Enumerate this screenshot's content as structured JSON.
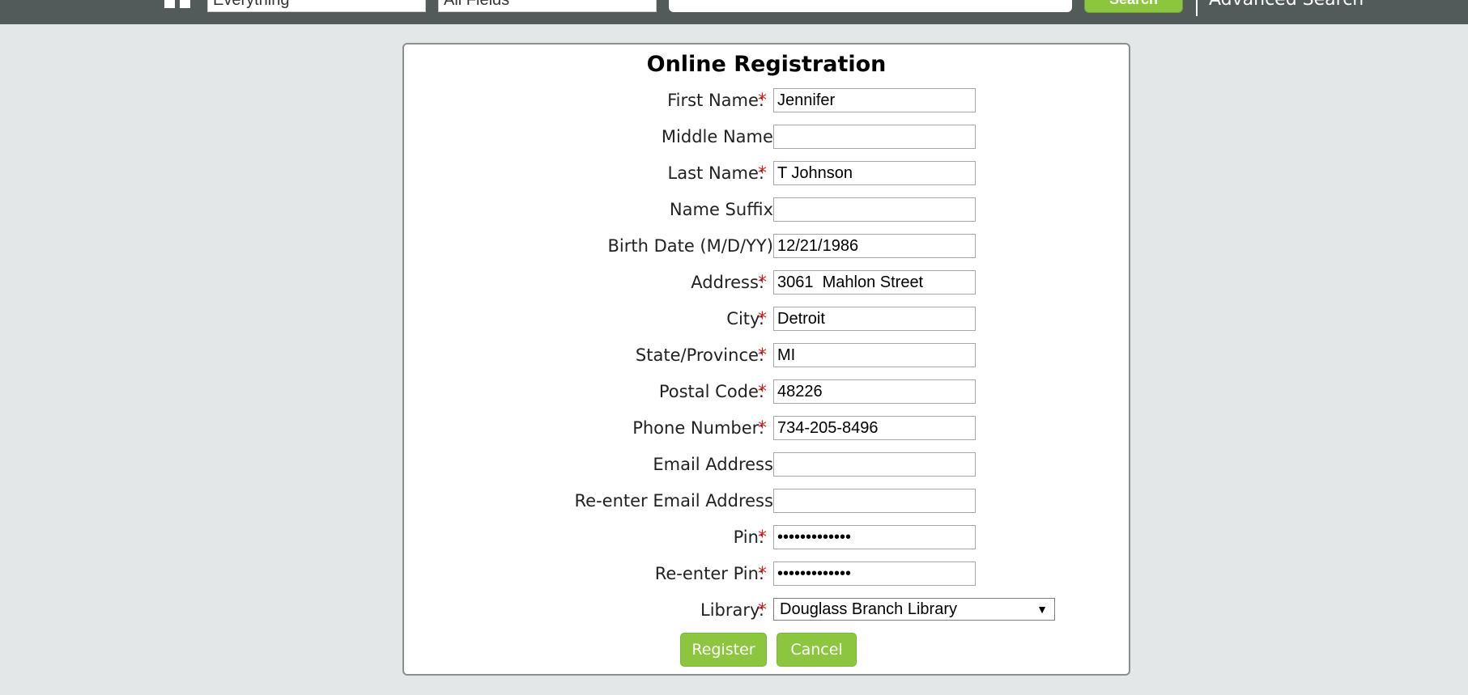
{
  "topbar": {
    "scope_select": "Everything",
    "field_select": "All Fields",
    "search_value": "",
    "search_button": "Search",
    "advanced_search": "Advanced Search"
  },
  "form": {
    "title": "Online Registration",
    "fields": [
      {
        "label": "First Name:",
        "required": true,
        "value": "Jennifer"
      },
      {
        "label": "Middle Name:",
        "required": false,
        "value": ""
      },
      {
        "label": "Last Name:",
        "required": true,
        "value": "T Johnson"
      },
      {
        "label": "Name Suffix:",
        "required": false,
        "value": ""
      },
      {
        "label": "Birth Date (M/D/YY):",
        "required": false,
        "value": "12/21/1986"
      },
      {
        "label": "Address:",
        "required": true,
        "value": "3061  Mahlon Street"
      },
      {
        "label": "City:",
        "required": true,
        "value": "Detroit"
      },
      {
        "label": "State/Province:",
        "required": true,
        "value": "MI"
      },
      {
        "label": "Postal Code:",
        "required": true,
        "value": "48226"
      },
      {
        "label": "Phone Number:",
        "required": true,
        "value": "734-205-8496"
      },
      {
        "label": "Email Address:",
        "required": false,
        "value": ""
      },
      {
        "label": "Re-enter Email Address:",
        "required": false,
        "value": ""
      },
      {
        "label": "Pin:",
        "required": true,
        "value": "•••••••••••••"
      },
      {
        "label": "Re-enter Pin:",
        "required": true,
        "value": "•••••••••••••"
      }
    ],
    "required_mark": "*",
    "library": {
      "label": "Library:",
      "required": true,
      "value": "Douglass Branch Library",
      "arrow": "▼"
    },
    "register_button": "Register",
    "cancel_button": "Cancel"
  },
  "colors": {
    "accent": "#8cc63f",
    "topbar": "#535a5a",
    "background": "#e3e7e7",
    "required": "#e0201c"
  }
}
